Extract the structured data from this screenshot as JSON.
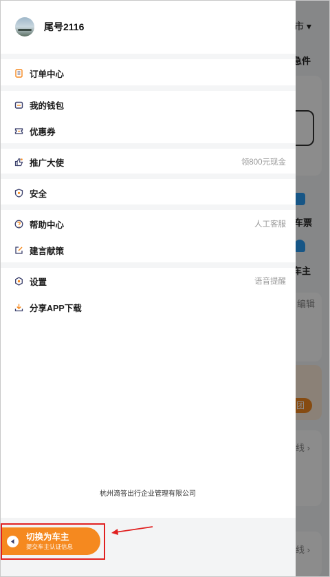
{
  "background_app": {
    "city_label": "市",
    "urgent_label": "急件",
    "ticket_label": "车票",
    "owner_label": "车主",
    "edit_label": "编辑",
    "line_label_1": "线",
    "line_label_2": "线",
    "pool_label": "团"
  },
  "profile": {
    "name": "尾号2116"
  },
  "menu": {
    "orders": {
      "label": "订单中心"
    },
    "wallet": {
      "label": "我的钱包"
    },
    "coupons": {
      "label": "优惠券"
    },
    "ambassador": {
      "label": "推广大使",
      "side": "领800元现金"
    },
    "security": {
      "label": "安全"
    },
    "help": {
      "label": "帮助中心",
      "side": "人工客服"
    },
    "feedback": {
      "label": "建言献策"
    },
    "settings": {
      "label": "设置",
      "side": "语音提醒"
    },
    "share": {
      "label": "分享APP下载"
    }
  },
  "footer": {
    "company": "杭州滴答出行企业管理有限公司"
  },
  "switch": {
    "title": "切换为车主",
    "subtitle": "提交车主认证信息"
  },
  "colors": {
    "accent": "#f5891f",
    "annotation": "#e02020",
    "icon_orange": "#f5891f",
    "icon_dark": "#3a3f6b"
  }
}
